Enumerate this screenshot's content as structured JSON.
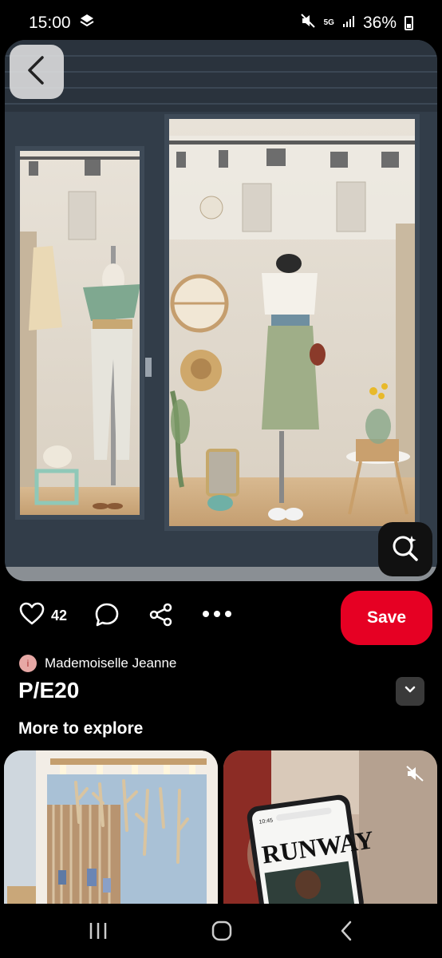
{
  "status_bar": {
    "time": "15:00",
    "network": "5G",
    "battery": "36%"
  },
  "pin": {
    "like_count": "42",
    "save_label": "Save",
    "author_initial": "i",
    "author_name": "Mademoiselle Jeanne",
    "title": "P/E20"
  },
  "explore": {
    "heading": "More to explore",
    "right_thumb_headline": "RUNWAY",
    "right_thumb_time": "10:45"
  },
  "colors": {
    "save": "#e60023",
    "background": "#000000"
  }
}
